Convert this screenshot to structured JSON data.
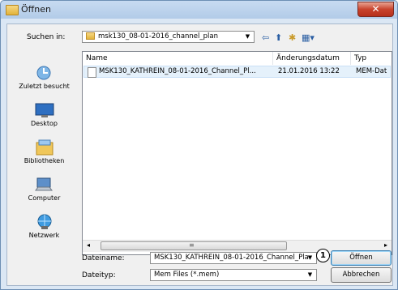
{
  "window": {
    "title": "Öffnen",
    "close_glyph": "✕"
  },
  "look_in": {
    "label": "Suchen in:",
    "value": "msk130_08-01-2016_channel_plan"
  },
  "places": [
    {
      "label": "Zuletzt besucht",
      "icon": "recent-places-icon"
    },
    {
      "label": "Desktop",
      "icon": "desktop-icon"
    },
    {
      "label": "Bibliotheken",
      "icon": "libraries-icon"
    },
    {
      "label": "Computer",
      "icon": "computer-icon"
    },
    {
      "label": "Netzwerk",
      "icon": "network-icon"
    }
  ],
  "columns": {
    "name": "Name",
    "date": "Änderungsdatum",
    "type": "Typ"
  },
  "files": [
    {
      "name": "MSK130_KATHREIN_08-01-2016_Channel_Pl...",
      "date": "21.01.2016 13:22",
      "type": "MEM-Dat"
    }
  ],
  "filename": {
    "label": "Dateiname:",
    "value": "MSK130_KATHREIN_08-01-2016_Channel_Pla"
  },
  "filetype": {
    "label": "Dateityp:",
    "value": "Mem Files (*.mem)"
  },
  "buttons": {
    "open": "Öffnen",
    "cancel": "Abbrechen"
  },
  "callout": {
    "number": "1"
  },
  "scroll_glyph": "≡"
}
